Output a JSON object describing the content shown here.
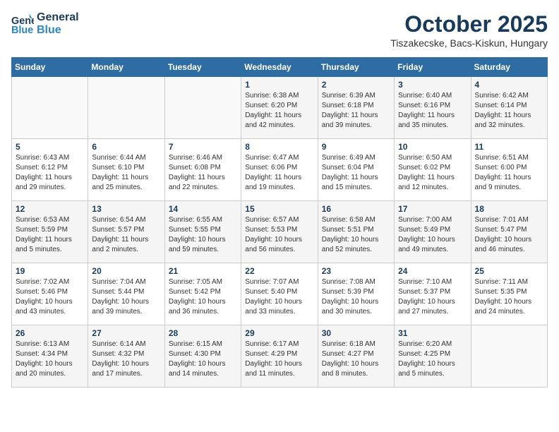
{
  "header": {
    "logo_line1": "General",
    "logo_line2": "Blue",
    "month": "October 2025",
    "location": "Tiszakecske, Bacs-Kiskun, Hungary"
  },
  "weekdays": [
    "Sunday",
    "Monday",
    "Tuesday",
    "Wednesday",
    "Thursday",
    "Friday",
    "Saturday"
  ],
  "weeks": [
    [
      {
        "day": "",
        "info": ""
      },
      {
        "day": "",
        "info": ""
      },
      {
        "day": "",
        "info": ""
      },
      {
        "day": "1",
        "info": "Sunrise: 6:38 AM\nSunset: 6:20 PM\nDaylight: 11 hours\nand 42 minutes."
      },
      {
        "day": "2",
        "info": "Sunrise: 6:39 AM\nSunset: 6:18 PM\nDaylight: 11 hours\nand 39 minutes."
      },
      {
        "day": "3",
        "info": "Sunrise: 6:40 AM\nSunset: 6:16 PM\nDaylight: 11 hours\nand 35 minutes."
      },
      {
        "day": "4",
        "info": "Sunrise: 6:42 AM\nSunset: 6:14 PM\nDaylight: 11 hours\nand 32 minutes."
      }
    ],
    [
      {
        "day": "5",
        "info": "Sunrise: 6:43 AM\nSunset: 6:12 PM\nDaylight: 11 hours\nand 29 minutes."
      },
      {
        "day": "6",
        "info": "Sunrise: 6:44 AM\nSunset: 6:10 PM\nDaylight: 11 hours\nand 25 minutes."
      },
      {
        "day": "7",
        "info": "Sunrise: 6:46 AM\nSunset: 6:08 PM\nDaylight: 11 hours\nand 22 minutes."
      },
      {
        "day": "8",
        "info": "Sunrise: 6:47 AM\nSunset: 6:06 PM\nDaylight: 11 hours\nand 19 minutes."
      },
      {
        "day": "9",
        "info": "Sunrise: 6:49 AM\nSunset: 6:04 PM\nDaylight: 11 hours\nand 15 minutes."
      },
      {
        "day": "10",
        "info": "Sunrise: 6:50 AM\nSunset: 6:02 PM\nDaylight: 11 hours\nand 12 minutes."
      },
      {
        "day": "11",
        "info": "Sunrise: 6:51 AM\nSunset: 6:00 PM\nDaylight: 11 hours\nand 9 minutes."
      }
    ],
    [
      {
        "day": "12",
        "info": "Sunrise: 6:53 AM\nSunset: 5:59 PM\nDaylight: 11 hours\nand 5 minutes."
      },
      {
        "day": "13",
        "info": "Sunrise: 6:54 AM\nSunset: 5:57 PM\nDaylight: 11 hours\nand 2 minutes."
      },
      {
        "day": "14",
        "info": "Sunrise: 6:55 AM\nSunset: 5:55 PM\nDaylight: 10 hours\nand 59 minutes."
      },
      {
        "day": "15",
        "info": "Sunrise: 6:57 AM\nSunset: 5:53 PM\nDaylight: 10 hours\nand 56 minutes."
      },
      {
        "day": "16",
        "info": "Sunrise: 6:58 AM\nSunset: 5:51 PM\nDaylight: 10 hours\nand 52 minutes."
      },
      {
        "day": "17",
        "info": "Sunrise: 7:00 AM\nSunset: 5:49 PM\nDaylight: 10 hours\nand 49 minutes."
      },
      {
        "day": "18",
        "info": "Sunrise: 7:01 AM\nSunset: 5:47 PM\nDaylight: 10 hours\nand 46 minutes."
      }
    ],
    [
      {
        "day": "19",
        "info": "Sunrise: 7:02 AM\nSunset: 5:46 PM\nDaylight: 10 hours\nand 43 minutes."
      },
      {
        "day": "20",
        "info": "Sunrise: 7:04 AM\nSunset: 5:44 PM\nDaylight: 10 hours\nand 39 minutes."
      },
      {
        "day": "21",
        "info": "Sunrise: 7:05 AM\nSunset: 5:42 PM\nDaylight: 10 hours\nand 36 minutes."
      },
      {
        "day": "22",
        "info": "Sunrise: 7:07 AM\nSunset: 5:40 PM\nDaylight: 10 hours\nand 33 minutes."
      },
      {
        "day": "23",
        "info": "Sunrise: 7:08 AM\nSunset: 5:39 PM\nDaylight: 10 hours\nand 30 minutes."
      },
      {
        "day": "24",
        "info": "Sunrise: 7:10 AM\nSunset: 5:37 PM\nDaylight: 10 hours\nand 27 minutes."
      },
      {
        "day": "25",
        "info": "Sunrise: 7:11 AM\nSunset: 5:35 PM\nDaylight: 10 hours\nand 24 minutes."
      }
    ],
    [
      {
        "day": "26",
        "info": "Sunrise: 6:13 AM\nSunset: 4:34 PM\nDaylight: 10 hours\nand 20 minutes."
      },
      {
        "day": "27",
        "info": "Sunrise: 6:14 AM\nSunset: 4:32 PM\nDaylight: 10 hours\nand 17 minutes."
      },
      {
        "day": "28",
        "info": "Sunrise: 6:15 AM\nSunset: 4:30 PM\nDaylight: 10 hours\nand 14 minutes."
      },
      {
        "day": "29",
        "info": "Sunrise: 6:17 AM\nSunset: 4:29 PM\nDaylight: 10 hours\nand 11 minutes."
      },
      {
        "day": "30",
        "info": "Sunrise: 6:18 AM\nSunset: 4:27 PM\nDaylight: 10 hours\nand 8 minutes."
      },
      {
        "day": "31",
        "info": "Sunrise: 6:20 AM\nSunset: 4:25 PM\nDaylight: 10 hours\nand 5 minutes."
      },
      {
        "day": "",
        "info": ""
      }
    ]
  ]
}
